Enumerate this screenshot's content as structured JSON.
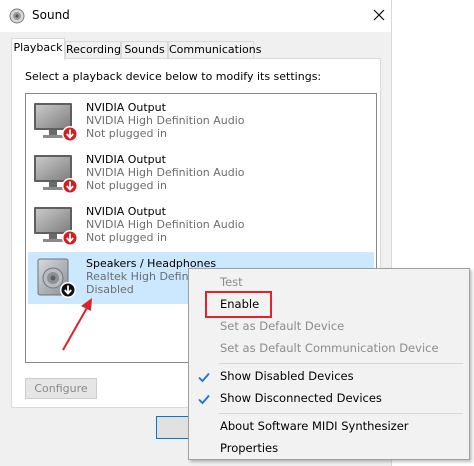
{
  "window": {
    "title": "Sound",
    "close_glyph": "✕"
  },
  "tabs": [
    {
      "label": "Playback",
      "active": true
    },
    {
      "label": "Recording",
      "active": false
    },
    {
      "label": "Sounds",
      "active": false
    },
    {
      "label": "Communications",
      "active": false
    }
  ],
  "panel": {
    "instruction": "Select a playback device below to modify its settings:"
  },
  "devices": [
    {
      "name": "NVIDIA Output",
      "description": "NVIDIA High Definition Audio",
      "status": "Not plugged in",
      "icon": "monitor-icon",
      "badge": "red-down-arrow"
    },
    {
      "name": "NVIDIA Output",
      "description": "NVIDIA High Definition Audio",
      "status": "Not plugged in",
      "icon": "monitor-icon",
      "badge": "red-down-arrow"
    },
    {
      "name": "NVIDIA Output",
      "description": "NVIDIA High Definition Audio",
      "status": "Not plugged in",
      "icon": "monitor-icon",
      "badge": "red-down-arrow"
    },
    {
      "name": "Speakers / Headphones",
      "description": "Realtek High Definition",
      "status": "Disabled",
      "icon": "speaker-icon",
      "badge": "black-down-arrow",
      "selected": true
    }
  ],
  "buttons": {
    "configure": "Configure"
  },
  "context_menu": {
    "items": [
      {
        "label": "Test",
        "enabled": false,
        "checked": false
      },
      {
        "label": "Enable",
        "enabled": true,
        "checked": false,
        "highlighted_box": true
      },
      {
        "label": "Set as Default Device",
        "enabled": false,
        "checked": false
      },
      {
        "label": "Set as Default Communication Device",
        "enabled": false,
        "checked": false
      },
      {
        "label": "Show Disabled Devices",
        "enabled": true,
        "checked": true
      },
      {
        "label": "Show Disconnected Devices",
        "enabled": true,
        "checked": true
      },
      {
        "label": "About Software MIDI Synthesizer",
        "enabled": true,
        "checked": false
      },
      {
        "label": "Properties",
        "enabled": true,
        "checked": false
      }
    ]
  },
  "colors": {
    "selection": "#cce8ff",
    "highlight_box": "#e0242b",
    "annotation_arrow": "#d9232a",
    "check": "#1a73d9"
  }
}
